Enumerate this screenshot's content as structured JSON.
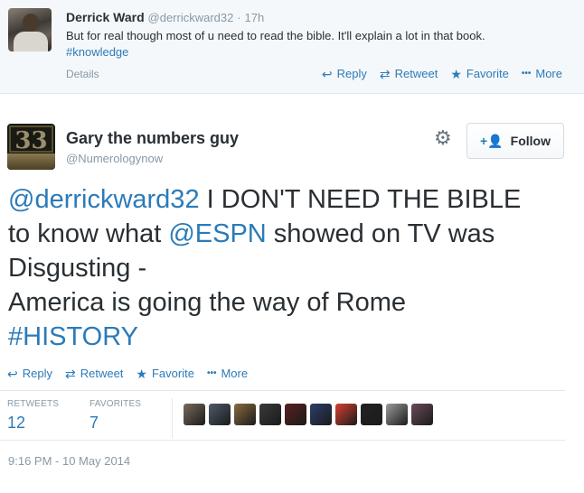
{
  "parent_tweet": {
    "name": "Derrick Ward",
    "handle": "@derrickward32",
    "dot": "·",
    "time": "17h",
    "text": "But for real though most of u need to read the bible. It'll explain a lot in that book.",
    "hashtag": "#knowledge",
    "details_label": "Details",
    "actions": {
      "reply": "Reply",
      "retweet": "Retweet",
      "favorite": "Favorite",
      "more": "More"
    }
  },
  "main_tweet": {
    "avatar_text": "33",
    "name": "Gary the numbers guy",
    "handle": "@Numerologynow",
    "follow_label": "Follow",
    "text": {
      "mention_1": "@derrickward32",
      "part_1": " I DON'T NEED THE BIBLE",
      "part_2": "to know what ",
      "mention_2": "@ESPN",
      "part_3": " showed on TV was",
      "part_4": "Disgusting -",
      "part_5": "America is going the way of Rome",
      "hashtag": "#HISTORY"
    },
    "actions": {
      "reply": "Reply",
      "retweet": "Retweet",
      "favorite": "Favorite",
      "more": "More"
    },
    "stats": {
      "retweets_label": "RETWEETS",
      "retweets": "12",
      "favorites_label": "FAVORITES",
      "favorites": "7"
    },
    "timestamp": "9:16 PM - 10 May 2014"
  },
  "icons": {
    "reply": "↩",
    "retweet": "⇄",
    "favorite": "★",
    "more": "•••",
    "gear": "⚙",
    "follow": "+👤"
  },
  "colors": {
    "link": "#2b7bb9",
    "muted": "#8899a6",
    "text": "#292f33",
    "parent_bg": "#f5f8fa",
    "border": "#e1e8ed"
  },
  "favoriter_avatar_colors": [
    "#7a6a5c",
    "#4d5a6a",
    "#8a6b3f",
    "#3a3a3a",
    "#5b1f1f",
    "#2c3e6b",
    "#d8402f",
    "#222222",
    "#9b9b9b",
    "#6a4a5a"
  ]
}
